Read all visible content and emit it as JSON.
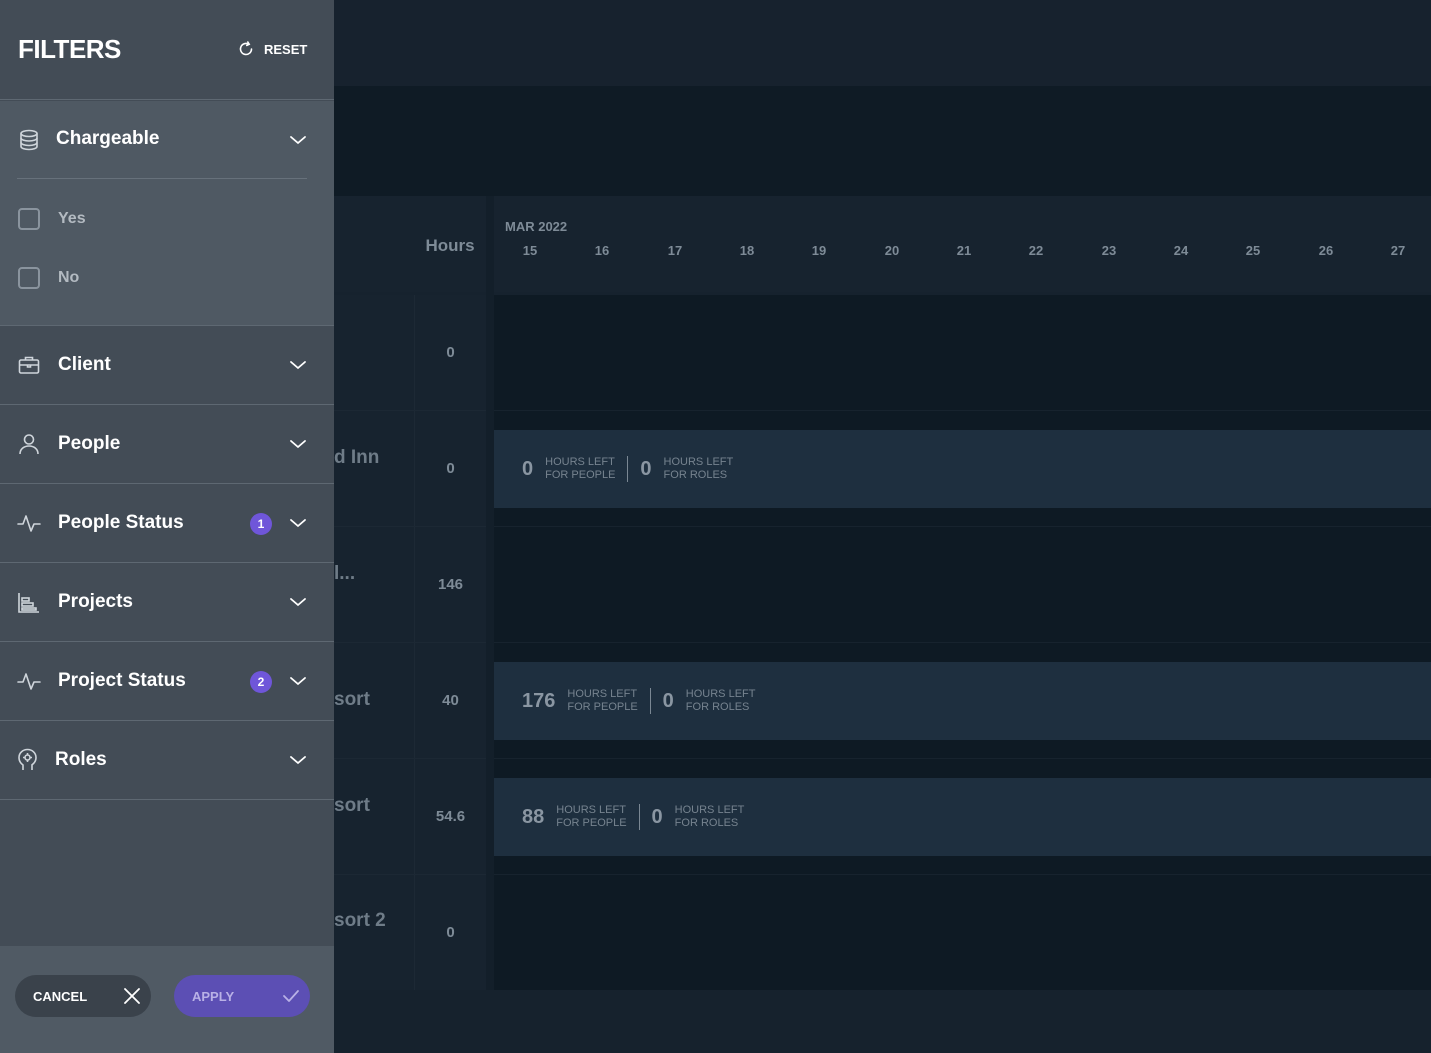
{
  "panel": {
    "title": "FILTERS",
    "reset_label": "RESET",
    "sections": {
      "chargeable": {
        "label": "Chargeable",
        "options": [
          "Yes",
          "No"
        ]
      },
      "client": {
        "label": "Client"
      },
      "people": {
        "label": "People"
      },
      "people_status": {
        "label": "People Status",
        "badge": "1"
      },
      "projects": {
        "label": "Projects"
      },
      "project_status": {
        "label": "Project Status",
        "badge": "2"
      },
      "roles": {
        "label": "Roles"
      }
    },
    "cancel_label": "CANCEL",
    "apply_label": "APPLY",
    "accent_color": "#6f56d9"
  },
  "schedule": {
    "hours_header": "Hours",
    "month": "MAR 2022",
    "days": [
      "15",
      "16",
      "17",
      "18",
      "19",
      "20",
      "21",
      "22",
      "23",
      "24",
      "25",
      "26",
      "27"
    ],
    "rows": [
      {
        "name": "",
        "hours": "0"
      },
      {
        "name": "d Inn",
        "hours": "0"
      },
      {
        "name": "l...",
        "hours": "146"
      },
      {
        "name": "sort",
        "hours": "40"
      },
      {
        "name": "sort",
        "hours": "54.6"
      },
      {
        "name": "sort 2",
        "hours": "0"
      }
    ],
    "bars": [
      {
        "people": "0",
        "people_label_1": "HOURS LEFT",
        "people_label_2": "FOR PEOPLE",
        "roles": "0",
        "roles_label_1": "HOURS LEFT",
        "roles_label_2": "FOR ROLES"
      },
      {
        "people": "176",
        "people_label_1": "HOURS LEFT",
        "people_label_2": "FOR PEOPLE",
        "roles": "0",
        "roles_label_1": "HOURS LEFT",
        "roles_label_2": "FOR ROLES"
      },
      {
        "people": "88",
        "people_label_1": "HOURS LEFT",
        "people_label_2": "FOR PEOPLE",
        "roles": "0",
        "roles_label_1": "HOURS LEFT",
        "roles_label_2": "FOR ROLES"
      }
    ]
  }
}
